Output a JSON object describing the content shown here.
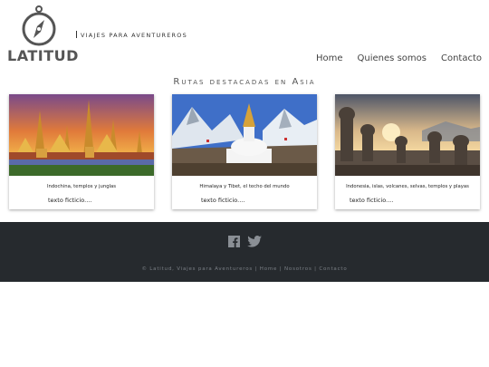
{
  "brand": {
    "name": "LATITUD",
    "tagline": "Viajes para aventureros"
  },
  "nav": {
    "items": [
      "Home",
      "Quienes somos",
      "Contacto"
    ]
  },
  "section": {
    "title": "Rutas destacadas en Asia"
  },
  "cards": [
    {
      "caption": "Indochina, templos y junglas",
      "text": "texto ficticio...."
    },
    {
      "caption": "Himalaya y Tibet, el techo del mundo",
      "text": "texto ficticio...."
    },
    {
      "caption": "Indonesia, islas, volcanes, selvas, templos y playas",
      "text": "texto ficticio...."
    }
  ],
  "footer": {
    "social": [
      "facebook-icon",
      "twitter-icon"
    ],
    "copyright": "© Latitud, Viajes para Aventureros | Home | Nosotros | Contacto"
  },
  "colors": {
    "footer_bg": "#262a2e",
    "logo_gray": "#555555"
  }
}
